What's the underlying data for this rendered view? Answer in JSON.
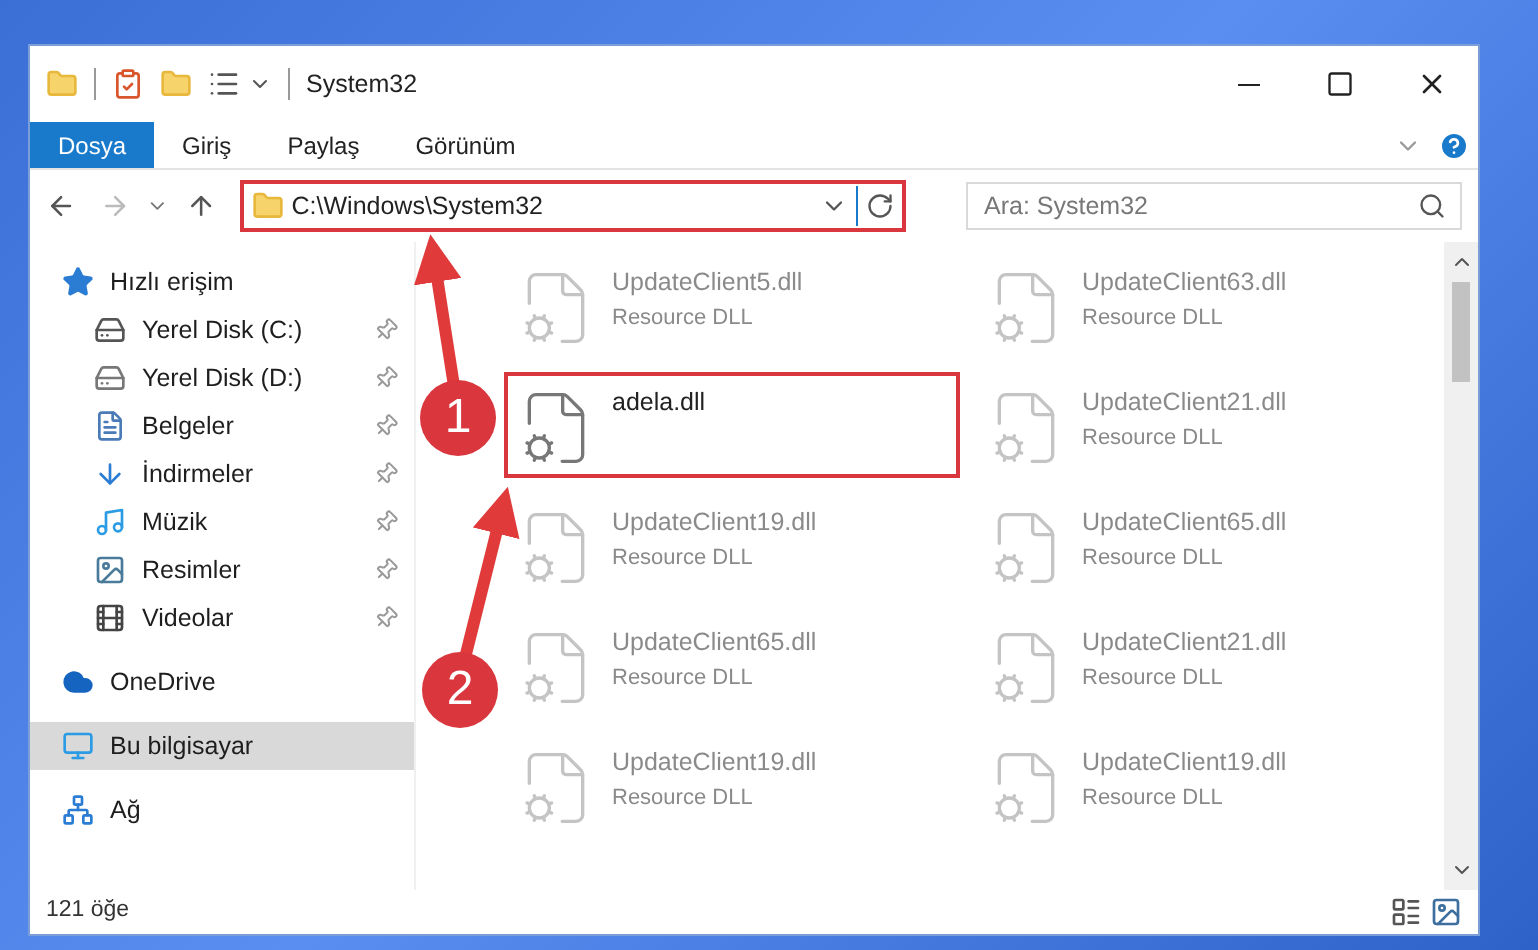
{
  "window": {
    "title": "System32"
  },
  "ribbon_tabs": [
    {
      "label": "Dosya",
      "selected": true
    },
    {
      "label": "Giriş",
      "selected": false
    },
    {
      "label": "Paylaş",
      "selected": false
    },
    {
      "label": "Görünüm",
      "selected": false
    }
  ],
  "address_bar": {
    "value": "C:\\Windows\\System32",
    "highlighted": true
  },
  "search": {
    "placeholder": "Ara: System32"
  },
  "sidebar": {
    "items": [
      {
        "label": "Hızlı erişim",
        "kind": "quick",
        "pinned": false,
        "selected": false,
        "children": [
          {
            "label": "Yerel Disk (C:)",
            "kind": "diskc",
            "pinned": true,
            "selected": false
          },
          {
            "label": "Yerel Disk (D:)",
            "kind": "disk",
            "pinned": true,
            "selected": false
          },
          {
            "label": "Belgeler",
            "kind": "docs",
            "pinned": true,
            "selected": false
          },
          {
            "label": "İndirmeler",
            "kind": "downloads",
            "pinned": true,
            "selected": false
          },
          {
            "label": "Müzik",
            "kind": "music",
            "pinned": true,
            "selected": false
          },
          {
            "label": "Resimler",
            "kind": "pictures",
            "pinned": true,
            "selected": false
          },
          {
            "label": "Videolar",
            "kind": "videos",
            "pinned": true,
            "selected": false
          }
        ]
      },
      {
        "label": "OneDrive",
        "kind": "cloud",
        "pinned": false,
        "selected": false
      },
      {
        "label": "Bu bilgisayar",
        "kind": "pc",
        "pinned": false,
        "selected": true
      },
      {
        "label": "Ağ",
        "kind": "network",
        "pinned": false,
        "selected": false
      }
    ]
  },
  "files": [
    {
      "name": "UpdateClient5.dll",
      "type": "Resource DLL",
      "faded": true,
      "highlighted": false
    },
    {
      "name": "UpdateClient63.dll",
      "type": "Resource DLL",
      "faded": true,
      "highlighted": false
    },
    {
      "name": "adela.dll",
      "faded": false,
      "highlighted": true
    },
    {
      "name": "UpdateClient21.dll",
      "type": "Resource DLL",
      "faded": true,
      "highlighted": false
    },
    {
      "name": "UpdateClient19.dll",
      "type": "Resource DLL",
      "faded": true,
      "highlighted": false
    },
    {
      "name": "UpdateClient65.dll",
      "type": "Resource DLL",
      "faded": true,
      "highlighted": false
    },
    {
      "name": "UpdateClient65.dll",
      "type": "Resource DLL",
      "faded": true,
      "highlighted": false
    },
    {
      "name": "UpdateClient21.dll",
      "type": "Resource DLL",
      "faded": true,
      "highlighted": false
    },
    {
      "name": "UpdateClient19.dll",
      "type": "Resource DLL",
      "faded": true,
      "highlighted": false
    },
    {
      "name": "UpdateClient19.dll",
      "type": "Resource DLL",
      "faded": true,
      "highlighted": false
    }
  ],
  "status_bar": {
    "count": "121 öğe"
  },
  "annotations": [
    {
      "label": "1"
    },
    {
      "label": "2"
    }
  ]
}
